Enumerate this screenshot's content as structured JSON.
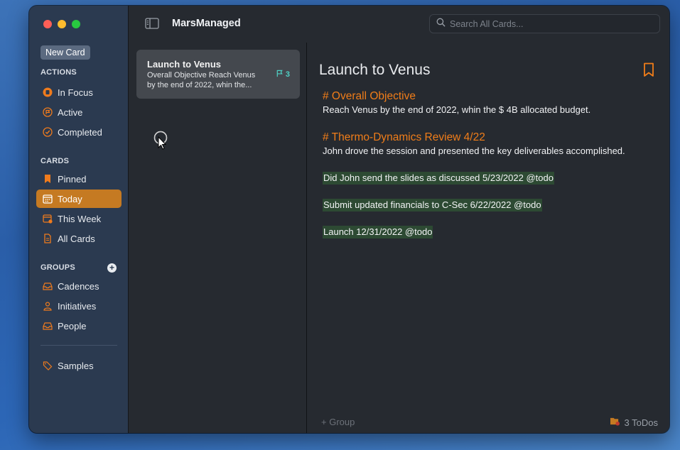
{
  "window": {
    "app_title": "MarsManaged",
    "search_placeholder": "Search All Cards..."
  },
  "sidebar": {
    "new_card_label": "New Card",
    "actions_title": "ACTIONS",
    "actions": [
      {
        "label": "In Focus",
        "icon": "focus-icon"
      },
      {
        "label": "Active",
        "icon": "flag-circle-icon"
      },
      {
        "label": "Completed",
        "icon": "check-circle-icon"
      }
    ],
    "cards_title": "CARDS",
    "cards": [
      {
        "label": "Pinned",
        "icon": "bookmark-icon"
      },
      {
        "label": "Today",
        "icon": "calendar-icon",
        "active": true
      },
      {
        "label": "This Week",
        "icon": "calendar-week-icon"
      },
      {
        "label": "All Cards",
        "icon": "document-icon"
      }
    ],
    "groups_title": "GROUPS",
    "add_group_symbol": "+",
    "groups": [
      {
        "label": "Cadences",
        "icon": "tray-icon"
      },
      {
        "label": "Initiatives",
        "icon": "person-icon"
      },
      {
        "label": "People",
        "icon": "tray-icon"
      }
    ],
    "samples_label": "Samples"
  },
  "list": {
    "card": {
      "title": "Launch to Venus",
      "subtitle": "Overall Objective Reach Venus by the end of 2022, whin the...",
      "count": "3"
    }
  },
  "detail": {
    "title": "Launch to Venus",
    "heading1": "# Overall Objective",
    "para1": "Reach Venus by the end of 2022, whin the $ 4B allocated budget.",
    "heading2": "# Thermo-Dynamics Review 4/22",
    "para2": "John drove the session and presented the key deliverables accomplished.",
    "todos": [
      "Did John send the slides as discussed 5/23/2022 @todo",
      "Submit updated financials to C-Sec 6/22/2022 @todo",
      "Launch 12/31/2022 @todo"
    ],
    "footer_group": "+ Group",
    "footer_todos": "3 ToDos"
  },
  "colors": {
    "accent": "#c57a22",
    "heading": "#f07d19",
    "todo_bg": "#2d4a33",
    "sidebar_bg": "#2b3a50",
    "count": "#4fd1c5"
  }
}
